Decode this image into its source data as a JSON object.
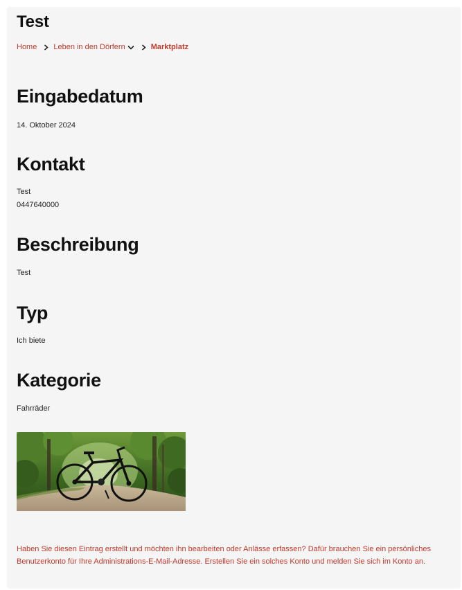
{
  "page": {
    "title": "Test"
  },
  "breadcrumb": {
    "home": "Home",
    "section": "Leben in den Dörfern",
    "current": "Marktplatz"
  },
  "fields": {
    "eingabedatum": {
      "heading": "Eingabedatum",
      "value": "14. Oktober 2024"
    },
    "kontakt": {
      "heading": "Kontakt",
      "name": "Test",
      "phone": "0447640000"
    },
    "beschreibung": {
      "heading": "Beschreibung",
      "value": "Test"
    },
    "typ": {
      "heading": "Typ",
      "value": "Ich biete"
    },
    "kategorie": {
      "heading": "Kategorie",
      "value": "Fahrräder"
    }
  },
  "image": {
    "subject": "bicycle-photo"
  },
  "notice": "Haben Sie diesen Eintrag erstellt und möchten ihn bearbeiten oder Anlässe erfassen? Dafür brauchen Sie ein persönliches Benutzerkonto für Ihre Administrations-E-Mail-Adresse. Erstellen Sie ein solches Konto und melden Sie sich im Konto an.",
  "colors": {
    "accent": "#c0392b",
    "background": "#f5f5f5",
    "text": "#111111"
  }
}
